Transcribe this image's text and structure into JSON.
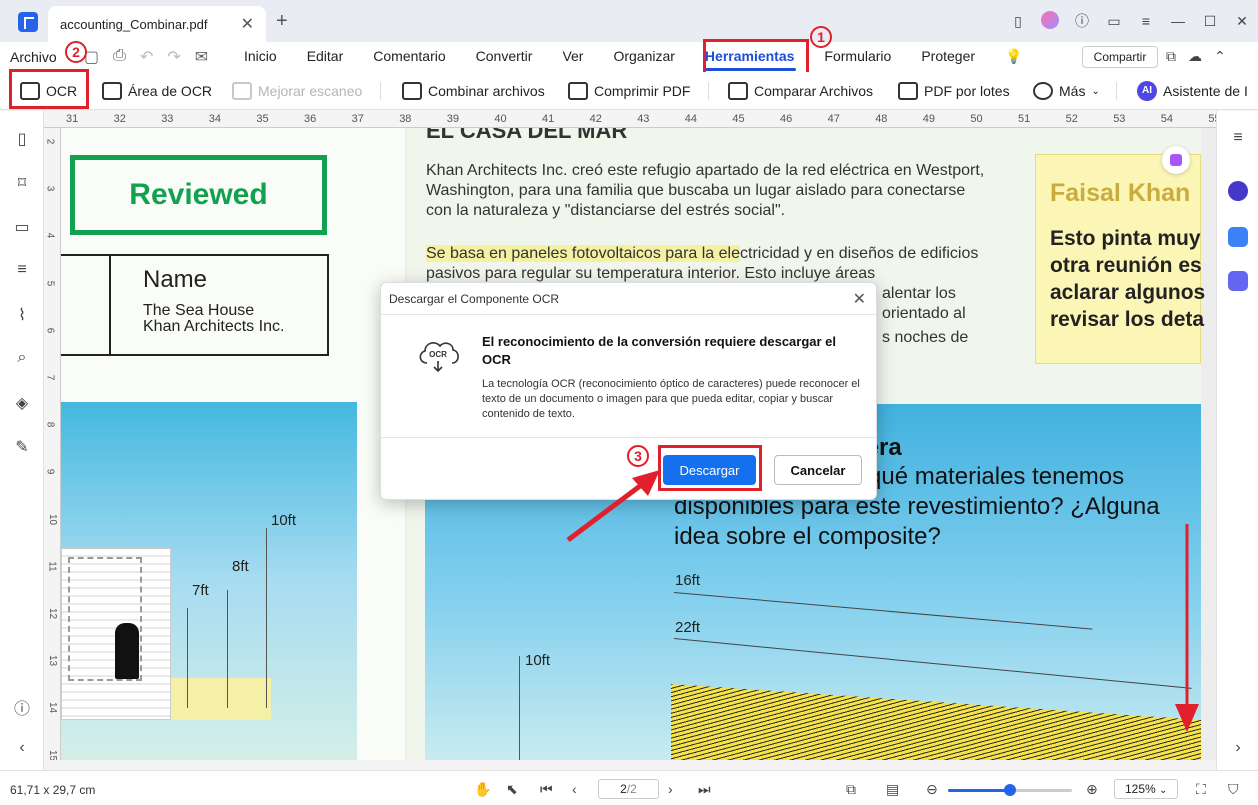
{
  "window": {
    "tab_title": "accounting_Combinar.pdf",
    "close_glyph": "✕",
    "add_glyph": "+"
  },
  "menubar": {
    "file": "Archivo",
    "items": [
      "Inicio",
      "Editar",
      "Comentario",
      "Convertir",
      "Ver",
      "Organizar",
      "Herramientas",
      "Formulario",
      "Proteger"
    ],
    "active_index": 6,
    "share": "Compartir"
  },
  "toolbar": {
    "ocr": "OCR",
    "ocr_area": "Área de OCR",
    "enhance_scan": "Mejorar escaneo",
    "combine": "Combinar archivos",
    "compress": "Comprimir PDF",
    "compare": "Comparar Archivos",
    "batch": "PDF por lotes",
    "more": "Más",
    "assistant": "Asistente de I",
    "ai_badge": "AI"
  },
  "annotations": {
    "step1": "1",
    "step2": "2",
    "step3": "3",
    "accent": "#e0202c"
  },
  "ruler": {
    "h_marks": [
      "31",
      "32",
      "33",
      "34",
      "35",
      "36",
      "37",
      "38",
      "39",
      "40",
      "41",
      "42",
      "43",
      "44",
      "45",
      "46",
      "47",
      "48",
      "49",
      "50",
      "51",
      "52",
      "53",
      "54",
      "55"
    ],
    "v_marks": [
      "2",
      "3",
      "4",
      "5",
      "6",
      "7",
      "8",
      "9",
      "10",
      "11",
      "12",
      "13",
      "14",
      "15"
    ]
  },
  "document": {
    "partial_heading": "EL CASA DEL MAR",
    "stamp": "Reviewed",
    "name_label": "Name",
    "name_line1": "The Sea House",
    "name_line2": "Khan Architects Inc.",
    "para1": "Khan Architects Inc. creó este refugio apartado de la red eléctrica en Westport, Washington, para una familia que buscaba un lugar aislado para conectarse con la naturaleza y \"distanciarse del estrés social\".",
    "para2_highlight": "Se basa en paneles fotovoltaicos para la ele",
    "para2_rest": "ctricidad y en diseños de edificios pasivos para regular su temperatura interior. Esto incluye áreas",
    "para2_tail1": "alentar los",
    "para2_tail2": "orientado al",
    "para2_tail3": "s noches de",
    "note_author": "Faisal Khan",
    "note_lines": [
      "Esto pinta muy",
      "otra reunión es",
      "aclarar algunos",
      "revisar los deta"
    ],
    "q_heading": "ladera",
    "q_text_line1": "ar qué materiales tenemos",
    "q_text_line2": "disponibles para este revestimiento? ¿Alguna",
    "q_text_line3": "idea sobre el composite?",
    "ft_10_left": "10ft",
    "ft_8": "8ft",
    "ft_7": "7ft",
    "ft_16": "16ft",
    "ft_22": "22ft",
    "ft_10_right": "10ft"
  },
  "modal": {
    "title": "Descargar el Componente OCR",
    "heading": "El reconocimiento de la conversión requiere descargar el OCR",
    "body": "La tecnología OCR (reconocimiento óptico de caracteres) puede reconocer el texto de un documento o imagen para que pueda editar, copiar y buscar contenido de texto.",
    "icon_text": "OCR",
    "download": "Descargar",
    "cancel": "Cancelar",
    "close_glyph": "✕"
  },
  "statusbar": {
    "coords": "61,71 x 29,7 cm",
    "page": "2",
    "total": "/2",
    "zoom": "125%",
    "zoom_fraction": 0.5
  }
}
